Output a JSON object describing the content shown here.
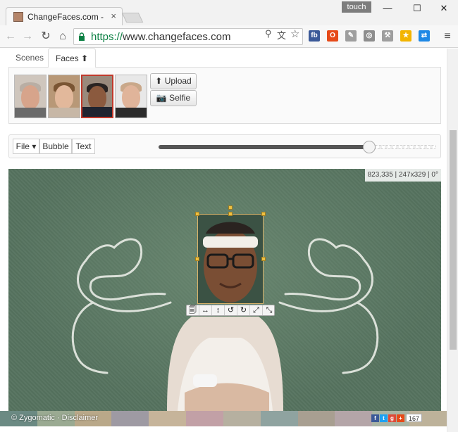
{
  "browser": {
    "tab_title": "ChangeFaces.com - Cha",
    "tab_close": "×",
    "touch_label": "touch",
    "url_scheme": "https://",
    "url_rest": "www.changefaces.com",
    "extensions": [
      {
        "name": "fb",
        "color": "#3b5998"
      },
      {
        "name": "office",
        "color": "#e64a19"
      },
      {
        "name": "edit",
        "color": "#9e9e9e"
      },
      {
        "name": "compass",
        "color": "#8d8d8d"
      },
      {
        "name": "tools",
        "color": "#9e9e9e"
      },
      {
        "name": "star",
        "color": "#f2b400"
      },
      {
        "name": "cast",
        "color": "#1e88e5"
      }
    ]
  },
  "app": {
    "tabs": [
      "Scenes",
      "Faces"
    ],
    "active_tab": "Faces",
    "face_thumbs": [
      "face-1",
      "face-2",
      "face-3",
      "face-4"
    ],
    "selected_face": "face-3",
    "upload_label": "Upload",
    "selfie_label": "Selfie",
    "file_label": "File",
    "bubble_label": "Bubble",
    "text_label": "Text",
    "slider_fraction": 0.76,
    "coords": "823,335 | 247x329 | 0°"
  },
  "footer": {
    "text": "© Zygomatic · Disclaimer",
    "share_count": "167",
    "swatches": [
      "#6b8a83",
      "#9aaa92",
      "#b9a889",
      "#9e9aa3",
      "#c6b49a",
      "#c2a0a6",
      "#b6b0a0",
      "#8fa3a0",
      "#a89f91",
      "#b4a5a8",
      "#a9b4a3",
      "#bdb29a"
    ]
  }
}
